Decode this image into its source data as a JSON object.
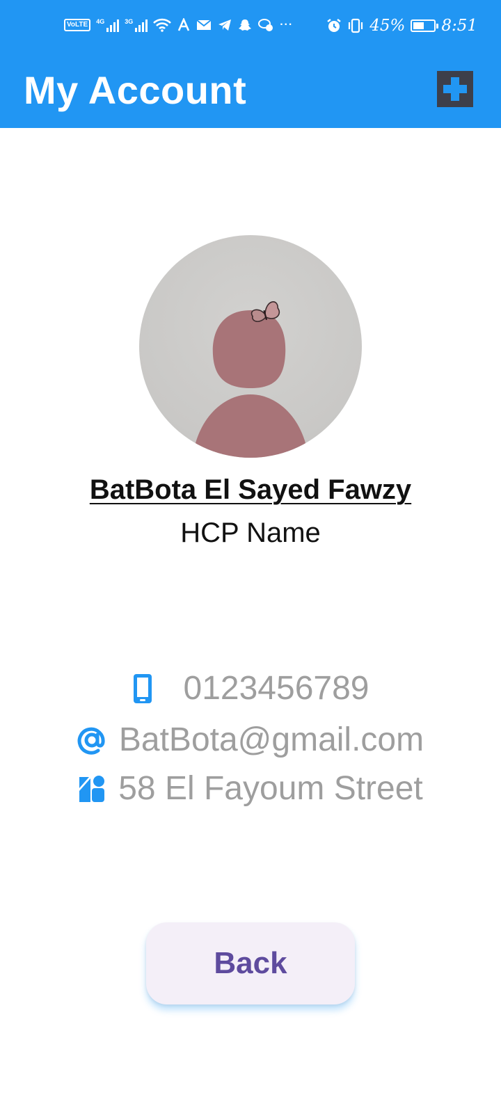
{
  "status_bar": {
    "volte": "VoLTE",
    "sim1_label": "4G",
    "sim2_label": "3G",
    "battery_percent": "45%",
    "battery_level": 0.45,
    "time": "8:51",
    "notification_icons": [
      "wifi-icon",
      "translate-icon",
      "mail-icon",
      "telegram-icon",
      "snapchat-icon",
      "chat-icon",
      "more-icon",
      "alarm-icon",
      "vibrate-icon"
    ]
  },
  "toolbar": {
    "title": "My Account",
    "add_icon": "plus-icon",
    "background": "#2196F3"
  },
  "profile": {
    "name": "BatBota El Sayed Fawzy",
    "subtitle": "HCP Name"
  },
  "contact": {
    "phone": "0123456789",
    "email": "BatBota@gmail.com",
    "address": "58 El Fayoum Street",
    "icon_color": "#2196F3",
    "phone_icon": "smartphone-icon",
    "email_icon": "at-sign-icon",
    "address_icon": "contact-card-icon"
  },
  "actions": {
    "back_label": "Back",
    "back_text_color": "#5E4B9E"
  }
}
